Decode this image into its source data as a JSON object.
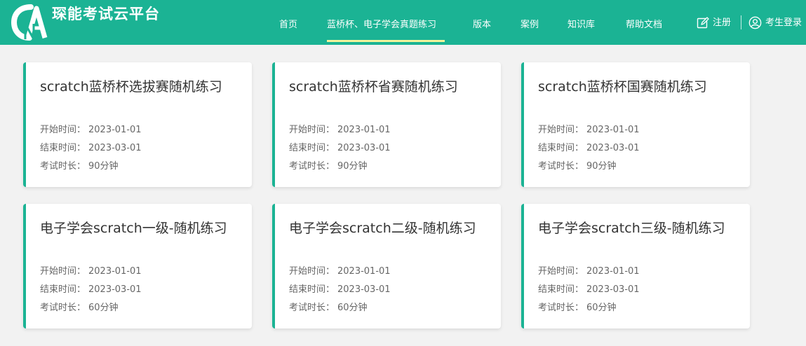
{
  "header": {
    "brand": "琛能考试云平台",
    "bg_color": "#1bb394",
    "active_underline_color": "#f2f39b",
    "nav": [
      {
        "label": "首页"
      },
      {
        "label": "蓝桥杯、电子学会真题练习",
        "active": true
      },
      {
        "label": "版本"
      },
      {
        "label": "案例"
      },
      {
        "label": "知识库"
      },
      {
        "label": "帮助文档"
      }
    ],
    "register": {
      "label": "注册",
      "icon": "edit-icon"
    },
    "login": {
      "label": "考生登录",
      "icon": "user-icon"
    }
  },
  "labels": {
    "start": "开始时间：",
    "end": "结束时间：",
    "duration": "考试时长："
  },
  "cards": [
    {
      "title": "scratch蓝桥杯选拔赛随机练习",
      "start": "2023-01-01",
      "end": "2023-03-01",
      "duration": "90分钟"
    },
    {
      "title": "scratch蓝桥杯省赛随机练习",
      "start": "2023-01-01",
      "end": "2023-03-01",
      "duration": "90分钟"
    },
    {
      "title": "scratch蓝桥杯国赛随机练习",
      "start": "2023-01-01",
      "end": "2023-03-01",
      "duration": "90分钟"
    },
    {
      "title": "电子学会scratch一级-随机练习",
      "start": "2023-01-01",
      "end": "2023-03-01",
      "duration": "60分钟"
    },
    {
      "title": "电子学会scratch二级-随机练习",
      "start": "2023-01-01",
      "end": "2023-03-01",
      "duration": "60分钟"
    },
    {
      "title": "电子学会scratch三级-随机练习",
      "start": "2023-01-01",
      "end": "2023-03-01",
      "duration": "60分钟"
    }
  ]
}
